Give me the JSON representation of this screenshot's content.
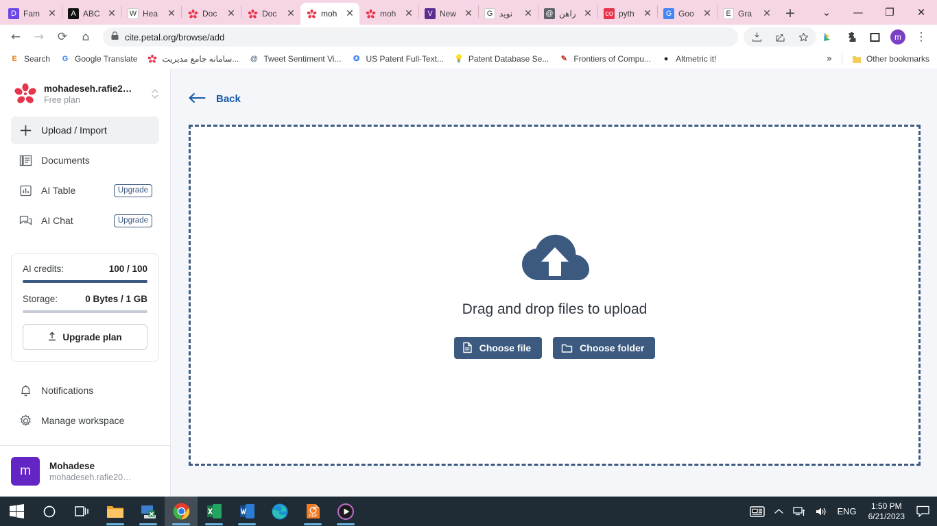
{
  "browser": {
    "tabs": [
      {
        "label": "Fam",
        "favicon": "dictionary-icon",
        "color": "#6b46e8",
        "glyph": "D",
        "active": false
      },
      {
        "label": "ABC",
        "favicon": "abc-icon",
        "color": "#111111",
        "glyph": "A",
        "active": false
      },
      {
        "label": "Hea",
        "favicon": "wikipedia-icon",
        "color": "#ffffff",
        "glyph": "W",
        "active": false
      },
      {
        "label": "Doc",
        "favicon": "petal-icon",
        "color": "#e8334a",
        "glyph": "*",
        "active": false
      },
      {
        "label": "Doc",
        "favicon": "petal-icon",
        "color": "#e8334a",
        "glyph": "*",
        "active": false
      },
      {
        "label": "moh",
        "favicon": "petal-icon",
        "color": "#e8334a",
        "glyph": "*",
        "active": true
      },
      {
        "label": "moh",
        "favicon": "petal-icon",
        "color": "#e8334a",
        "glyph": "*",
        "active": false
      },
      {
        "label": "New",
        "favicon": "vsm-icon",
        "color": "#5b2d91",
        "glyph": "V",
        "active": false
      },
      {
        "label": "نويد",
        "favicon": "google-icon",
        "color": "#ffffff",
        "glyph": "G",
        "active": false
      },
      {
        "label": "راهن",
        "favicon": "globe-icon",
        "color": "#5f6368",
        "glyph": "@",
        "active": false
      },
      {
        "label": "pyth",
        "favicon": "co-icon",
        "color": "#e8334a",
        "glyph": "co",
        "active": false
      },
      {
        "label": "Goo",
        "favicon": "google-docs-icon",
        "color": "#4285f4",
        "glyph": "G",
        "active": false
      },
      {
        "label": "Gra",
        "favicon": "e-icon",
        "color": "#ffffff",
        "glyph": "E",
        "active": false
      }
    ],
    "new_tab_label": "+",
    "window_controls": {
      "list": "⌄",
      "minimize": "—",
      "maximize": "❐",
      "close": "✕"
    },
    "nav": {
      "back": "←",
      "forward": "→",
      "reload": "⟳",
      "home": "⌂"
    },
    "omnibox": {
      "lock": "🔒",
      "url": "cite.petal.org/browse/add"
    },
    "toolbar_icons": [
      "downloads-icon",
      "share-icon",
      "bookmark-star-icon",
      "extension-bird-icon",
      "extensions-puzzle-icon",
      "sidepanel-icon"
    ],
    "profile_initial": "m",
    "menu": "⋮",
    "bookmarks": [
      {
        "label": "Search",
        "icon": "e-orange-icon",
        "glyph": "E",
        "color": "#e8821e"
      },
      {
        "label": "Google Translate",
        "icon": "google-translate-icon",
        "glyph": "G",
        "color": "#4285f4"
      },
      {
        "label": "سامانه جامع مدیریت...",
        "icon": "petal-icon",
        "glyph": "*",
        "color": "#e8334a"
      },
      {
        "label": "Tweet Sentiment Vi...",
        "icon": "globe-icon",
        "glyph": "@",
        "color": "#47607a"
      },
      {
        "label": "US Patent Full-Text...",
        "icon": "star-badge-icon",
        "glyph": "✪",
        "color": "#4285f4"
      },
      {
        "label": "Patent Database Se...",
        "icon": "bulb-icon",
        "glyph": "💡",
        "color": "#e8c531"
      },
      {
        "label": "Frontiers of Compu...",
        "icon": "pen-icon",
        "glyph": "✎",
        "color": "#c0392b"
      },
      {
        "label": "Altmetric it!",
        "icon": "globe-dark-icon",
        "glyph": "●",
        "color": "#222222"
      }
    ],
    "bookmarks_overflow": "»",
    "other_bookmarks": {
      "label": "Other bookmarks",
      "icon": "folder-icon"
    }
  },
  "sidebar": {
    "workspace": {
      "name": "mohadeseh.rafie2…",
      "plan": "Free plan",
      "logo": "petal-flower-logo"
    },
    "nav_items": [
      {
        "label": "Upload / Import",
        "icon": "plus-icon",
        "active": true,
        "badge": null
      },
      {
        "label": "Documents",
        "icon": "documents-icon",
        "active": false,
        "badge": null
      },
      {
        "label": "AI Table",
        "icon": "table-chart-icon",
        "active": false,
        "badge": "Upgrade"
      },
      {
        "label": "AI Chat",
        "icon": "chat-icon",
        "active": false,
        "badge": "Upgrade"
      }
    ],
    "usage": {
      "credits_label": "AI credits:",
      "credits_value": "100 / 100",
      "credits_percent": 100,
      "storage_label": "Storage:",
      "storage_value": "0 Bytes / 1 GB",
      "storage_percent": 0,
      "upgrade_button": "Upgrade plan",
      "upgrade_icon": "upload-arrow-icon"
    },
    "lower_items": [
      {
        "label": "Notifications",
        "icon": "bell-icon"
      },
      {
        "label": "Manage workspace",
        "icon": "gear-icon"
      }
    ],
    "account": {
      "initial": "m",
      "name": "Mohadese",
      "email": "mohadeseh.rafie20…"
    }
  },
  "main": {
    "back_label": "Back",
    "back_icon": "arrow-left-icon",
    "dropzone": {
      "icon": "cloud-upload-icon",
      "text": "Drag and drop files to upload",
      "choose_file_label": "Choose file",
      "choose_file_icon": "file-icon",
      "choose_folder_label": "Choose folder",
      "choose_folder_icon": "folder-icon"
    }
  },
  "taskbar": {
    "items": [
      {
        "name": "start-button",
        "icon": "windows-logo-icon"
      },
      {
        "name": "search-button",
        "icon": "circle-search-icon"
      },
      {
        "name": "task-view-button",
        "icon": "task-view-icon"
      },
      {
        "name": "file-explorer",
        "icon": "folder-icon",
        "open": true
      },
      {
        "name": "remote-desktop",
        "icon": "monitor-icon",
        "open": true
      },
      {
        "name": "chrome",
        "icon": "chrome-icon",
        "open": true,
        "focused": true
      },
      {
        "name": "excel",
        "icon": "excel-icon",
        "open": true
      },
      {
        "name": "word",
        "icon": "word-icon",
        "open": true
      },
      {
        "name": "edge",
        "icon": "edge-icon",
        "open": false
      },
      {
        "name": "gom-pdf",
        "icon": "pdf-icon",
        "open": true
      },
      {
        "name": "media-player",
        "icon": "play-circle-icon",
        "open": true
      }
    ],
    "tray": {
      "news_icon": "news-icon",
      "chevron": "⌃",
      "network_icon": "network-icon",
      "volume_icon": "volume-icon",
      "language": "ENG",
      "time": "1:50 PM",
      "date": "6/21/2023",
      "action_center_icon": "action-center-icon"
    }
  },
  "colors": {
    "tabstrip": "#f6d6e5",
    "accent": "#3c5a80",
    "link": "#1558a8",
    "avatar": "#6325c4",
    "content_bg": "#f4f6fa"
  }
}
